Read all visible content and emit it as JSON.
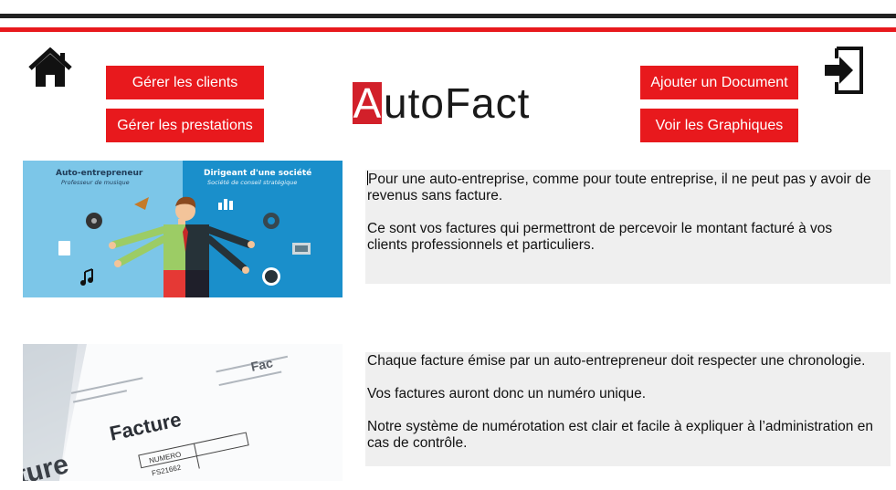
{
  "nav": {
    "manage_clients": "Gérer les clients",
    "manage_services": "Gérer les prestations",
    "add_document": "Ajouter un Document",
    "view_charts": "Voir les Graphiques"
  },
  "logo": {
    "first_letter": "A",
    "rest": "utoFact"
  },
  "illustration1": {
    "left_title": "Auto-entrepreneur",
    "left_subtitle": "Professeur de musique",
    "right_title": "Dirigeant d'une société",
    "right_subtitle": "Société de conseil stratégique"
  },
  "illustration2": {
    "heading": "Facture",
    "col1": "NUMERO",
    "value1": "FS21662",
    "partial_big": "ture",
    "partial_small": "Fac"
  },
  "section1": {
    "p1": "Pour une auto-entreprise, comme pour toute entreprise, il ne peut pas y avoir de revenus sans facture.",
    "p2": "Ce sont vos factures qui permettront de percevoir le montant facturé à vos clients professionnels et particuliers."
  },
  "section2": {
    "p1": "Chaque facture émise par un auto-entrepreneur doit respecter une chronologie.",
    "p2": "Vos factures auront donc un numéro unique.",
    "p3": "Notre système de numérotation est clair et facile à expliquer à l’administration en cas de contrôle."
  },
  "colors": {
    "accent_red": "#e8191d",
    "dark_bar": "#222222",
    "text_panel": "#efefef"
  },
  "icons": {
    "home": "home-icon",
    "logout": "logout-icon"
  }
}
